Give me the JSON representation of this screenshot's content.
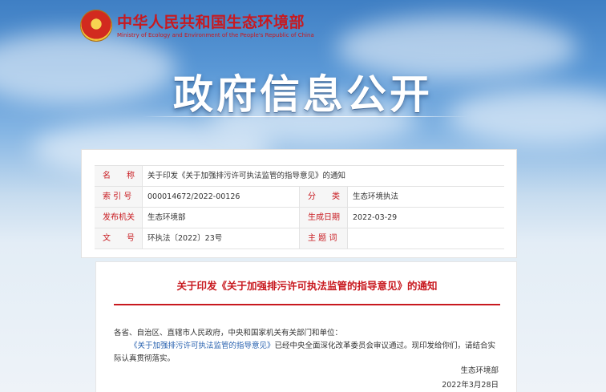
{
  "header": {
    "org_name_cn": "中华人民共和国生态环境部",
    "org_name_en": "Ministry of Ecology and Environment of the People's Republic of China",
    "emblem_icon": "national-emblem-icon"
  },
  "banner": {
    "title": "政府信息公开"
  },
  "meta": {
    "rows": [
      {
        "label": "名　　称",
        "value": "关于印发《关于加强排污许可执法监管的指导意见》的通知"
      },
      {
        "label": "索 引 号",
        "value": "000014672/2022-00126",
        "label2": "分　　类",
        "value2": "生态环境执法"
      },
      {
        "label": "发布机关",
        "value": "生态环境部",
        "label2": "生成日期",
        "value2": "2022-03-29"
      },
      {
        "label": "文　　号",
        "value": "环执法〔2022〕23号",
        "label2": "主 题 词",
        "value2": ""
      }
    ]
  },
  "article": {
    "title": "关于印发《关于加强排污许可执法监管的指导意见》的通知",
    "salutation": "各省、自治区、直辖市人民政府，中央和国家机关有关部门和单位：",
    "body_link": "《关于加强排污许可执法监管的指导意见》",
    "body_text": "已经中央全面深化改革委员会审议通过。现印发给你们，请结合实际认真贯彻落实。",
    "signature": "生态环境部",
    "date": "2022年3月28日"
  },
  "colors": {
    "accent_red": "#c8191f",
    "link_blue": "#2a63b0",
    "sky_blue": "#5a98d6"
  }
}
